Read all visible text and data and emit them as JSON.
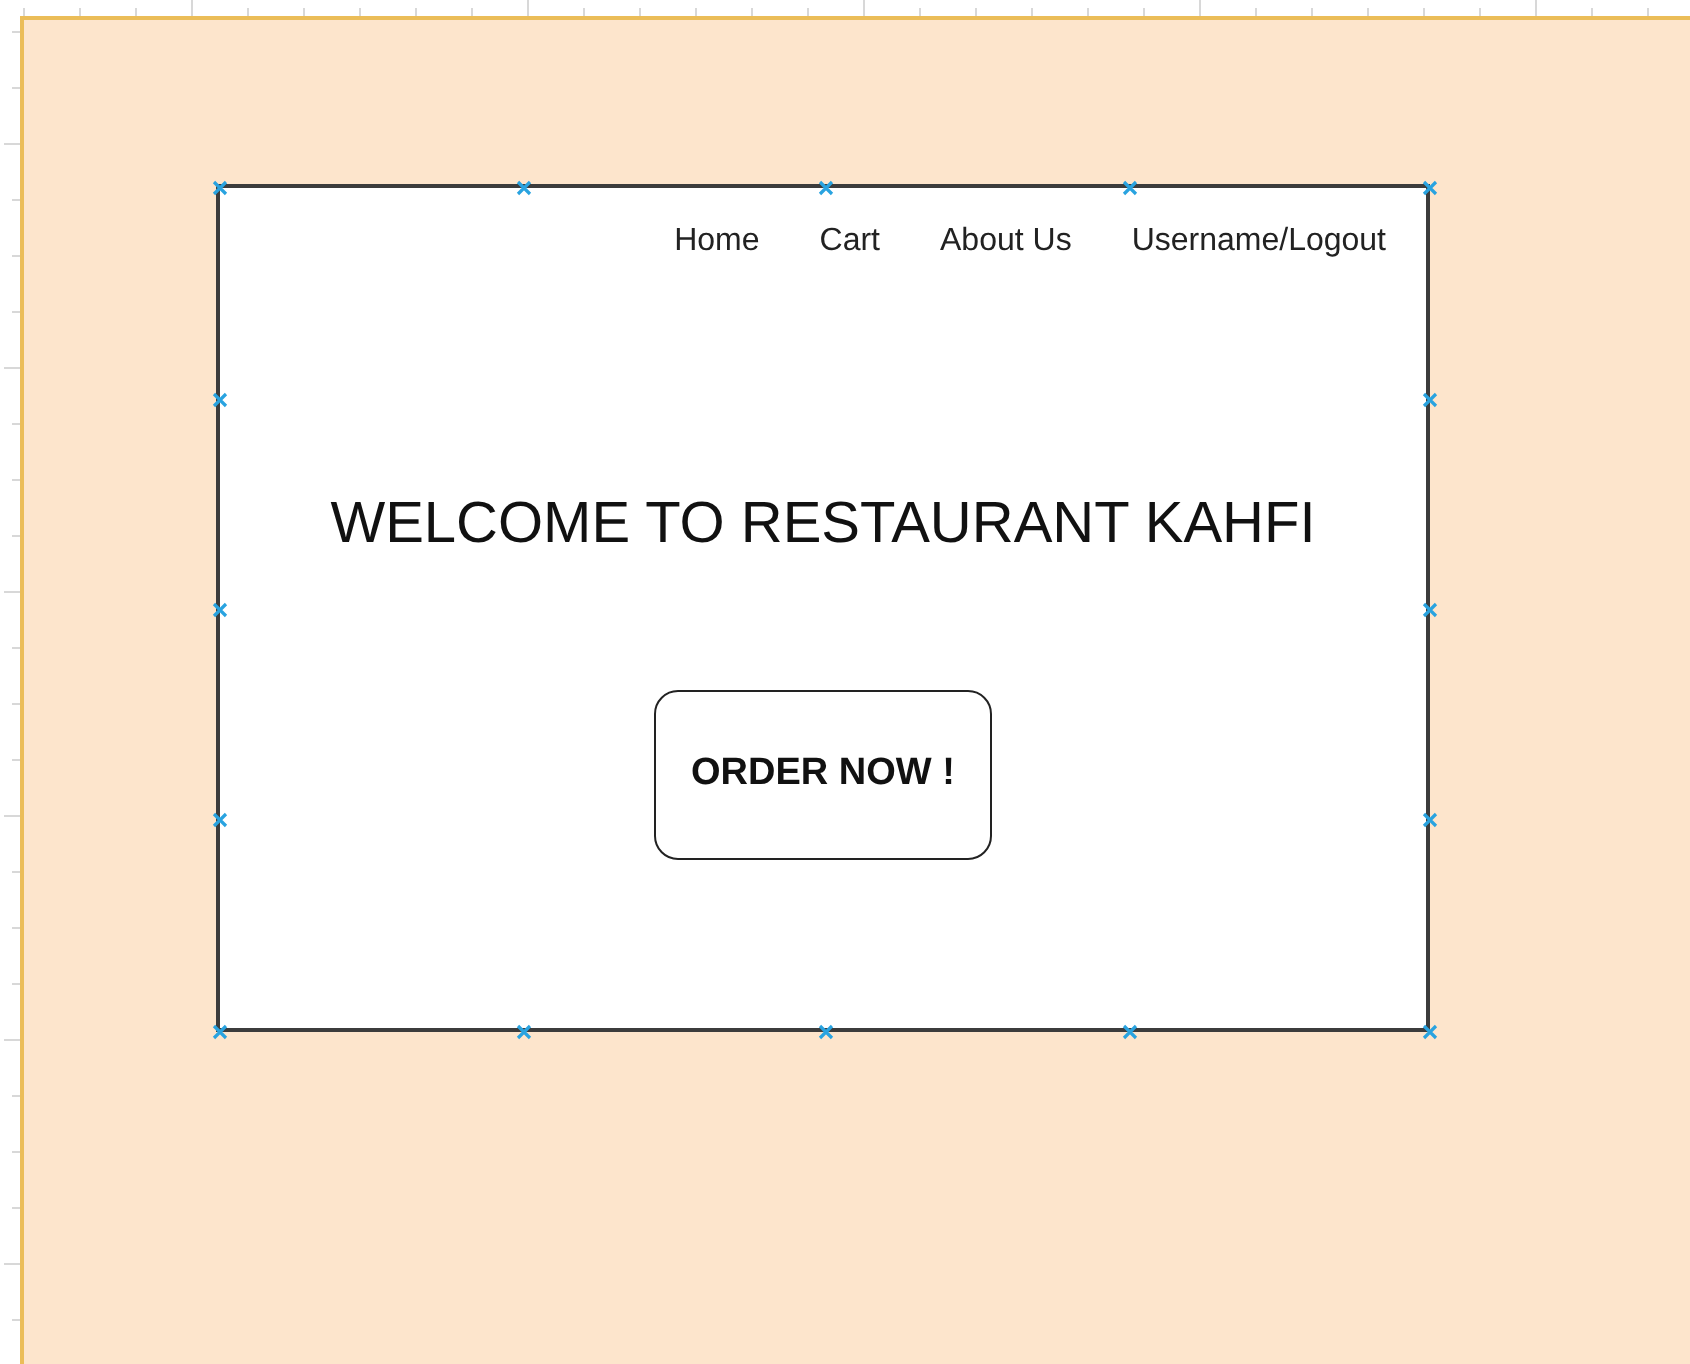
{
  "wireframe": {
    "nav": [
      {
        "label": "Home"
      },
      {
        "label": "Cart"
      },
      {
        "label": "About Us"
      },
      {
        "label": "Username/Logout"
      }
    ],
    "heading": "WELCOME TO RESTAURANT KAHFI",
    "button": "ORDER NOW !"
  }
}
